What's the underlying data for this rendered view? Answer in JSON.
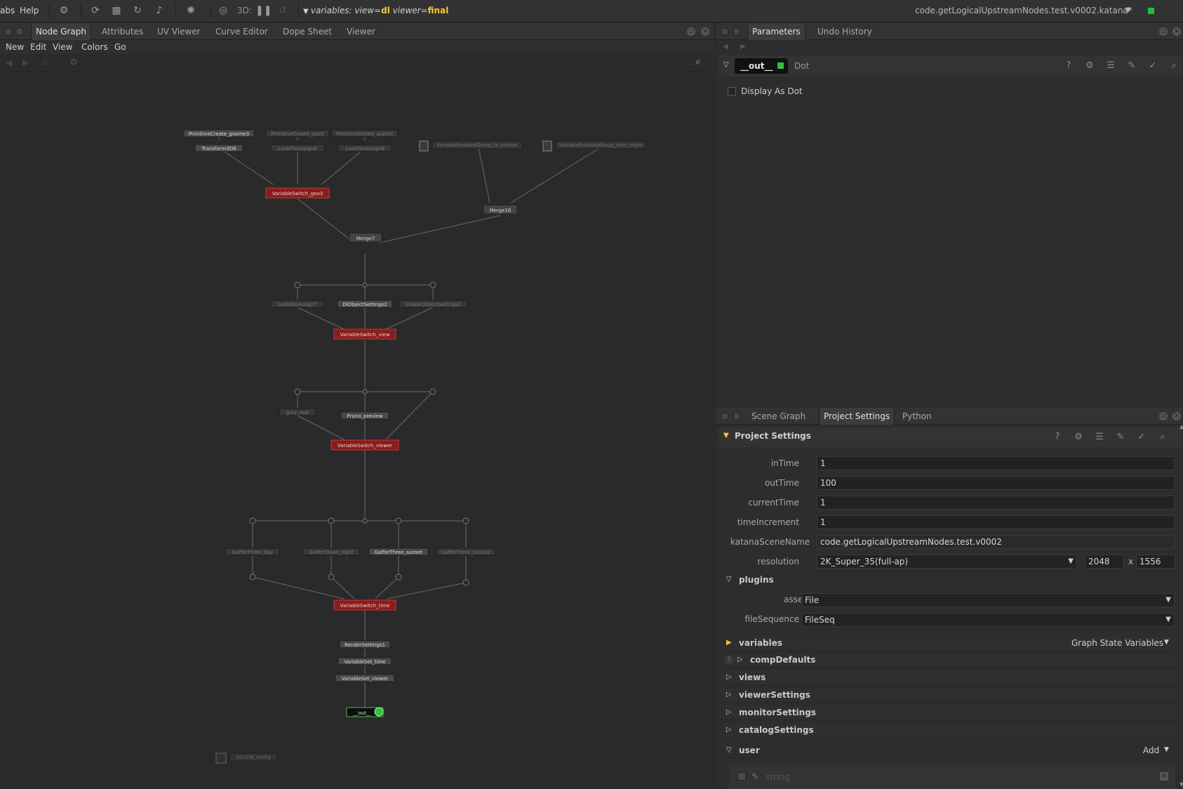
{
  "menubar": {
    "tabs_label": "abs",
    "help_label": "Help",
    "mode_3d": "3D:"
  },
  "variables": {
    "prefix": "variables:",
    "view_key": "view=",
    "view_val": "dl",
    "viewer_key": "viewer=",
    "viewer_val": "final"
  },
  "project_file": "code.getLogicalUpstreamNodes.test.v0002.katana*",
  "left_tabs": [
    "Node Graph",
    "Attributes",
    "UV Viewer",
    "Curve Editor",
    "Dope Sheet",
    "Viewer"
  ],
  "ng_menu": [
    "New",
    "Edit",
    "View",
    "Colors",
    "Go"
  ],
  "nodes": {
    "n1": "PrimitiveCreate_gnome3",
    "n2": "PrimitiveCreate_geo3",
    "n3": "PrimitiveCreate_plane1",
    "n4": "Transform3D6",
    "n5": "LookFileAssign8",
    "n6": "LookFileAssign9",
    "n7": "VariableEnabledGroup_fx_enable",
    "n8": "VariableEnabledGroup_time_night",
    "n9": "VariableSwitch_geo3",
    "n10": "Merge16",
    "n11": "Merge7",
    "n12": "LookFileAssign7",
    "n13": "DlObjectSettings2",
    "n14": "ViewerObjectSettings2",
    "n15": "VariableSwitch_view",
    "n16": "grey_mat",
    "n17": "Pruno_preview",
    "n18": "VariableSwitch_viewer",
    "n19": "GafferThree_day",
    "n20": "GafferThree_night",
    "n21": "GafferThree_sunset",
    "n22": "GafferThree_sunrise",
    "n23": "VariableSwitch_time",
    "n24": "RenderSettings1",
    "n25": "VariableSet_time",
    "n26": "VariableSet_viewer",
    "n27": "__out__",
    "n28": "OSVDB_config"
  },
  "params": {
    "tabs": [
      "Parameters",
      "Undo History"
    ],
    "node_name": "__out__",
    "node_type": "Dot",
    "display_as_dot": "Display As Dot"
  },
  "bottom": {
    "tabs": [
      "Scene Graph",
      "Project Settings",
      "Python"
    ],
    "title": "Project Settings",
    "fields": [
      {
        "label": "inTime",
        "value": "1"
      },
      {
        "label": "outTime",
        "value": "100"
      },
      {
        "label": "currentTime",
        "value": "1"
      },
      {
        "label": "timeIncrement",
        "value": "1"
      },
      {
        "label": "katanaSceneName",
        "value": "code.getLogicalUpstreamNodes.test.v0002"
      }
    ],
    "resolution": {
      "label": "resolution",
      "value": "2K_Super_35(full-ap)",
      "w": "2048",
      "x": "x",
      "h": "1556"
    },
    "plugins": {
      "label": "plugins",
      "asset_label": "asset",
      "asset_val": "File",
      "fileseq_label": "fileSequence",
      "fileseq_val": "FileSeq"
    },
    "groups": {
      "variables": "variables",
      "gsv": "Graph State Variables",
      "compDefaults": "compDefaults",
      "views": "views",
      "viewerSettings": "viewerSettings",
      "monitorSettings": "monitorSettings",
      "catalogSettings": "catalogSettings",
      "user": "user",
      "add": "Add"
    },
    "user_string": "string"
  }
}
